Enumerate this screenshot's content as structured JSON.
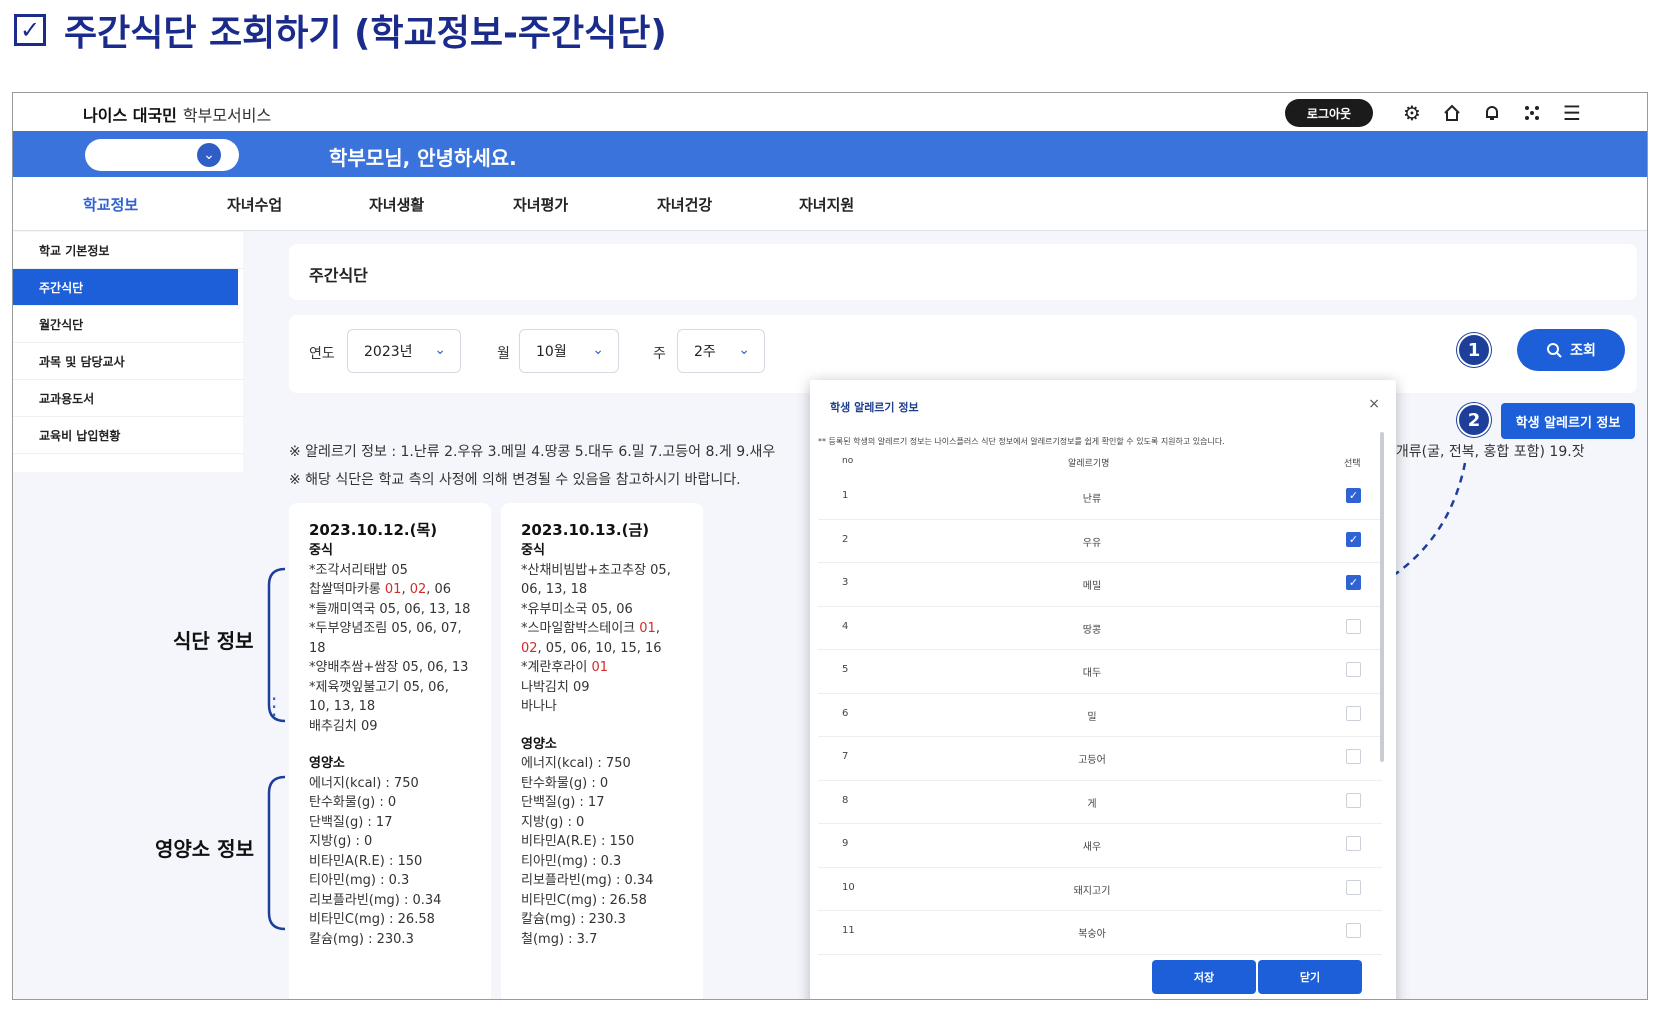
{
  "heading": {
    "checkbox": "☑",
    "title": "주간식단 조회하기 (학교정보-주간식단)"
  },
  "topbar": {
    "brand": "나이스 대국민",
    "brand_sub": "학부모서비스",
    "logout_label": "로그아웃",
    "icons": [
      "gear-icon",
      "home-icon",
      "bell-icon",
      "apps-icon",
      "menu-icon"
    ]
  },
  "hero": {
    "greeting": "학부모님, 안녕하세요."
  },
  "mainnav": {
    "tabs": [
      "학교정보",
      "자녀수업",
      "자녀생활",
      "자녀평가",
      "자녀건강",
      "자녀지원"
    ]
  },
  "sidebar": {
    "items": [
      "학교 기본정보",
      "주간식단",
      "월간식단",
      "과목 및 담당교사",
      "교과용도서",
      "교육비 납입현황"
    ]
  },
  "page_title": "주간식단",
  "filters": {
    "year_label": "연도",
    "year_value": "2023년",
    "month_label": "월",
    "month_value": "10월",
    "week_label": "주",
    "week_value": "2주",
    "search_label": "조회",
    "allergy_button": "학생 알레르기 정보"
  },
  "callouts": {
    "one": "1",
    "two": "2"
  },
  "notes": {
    "allergy": "※ 알레르기 정보 : 1.난류 2.우유 3.메밀 4.땅콩 5.대두 6.밀 7.고등어 8.게 9.새우",
    "allergy_tail": "조개류(굴, 전복, 홍합 포함) 19.잣",
    "change": "※ 해당 식단은 학교 측의 사정에 의해 변경될 수 있음을 참고하시기 바랍니다."
  },
  "labels": {
    "meal_info": "식단 정보",
    "nutrient_info": "영양소 정보"
  },
  "meals": [
    {
      "date": "2023.10.12.(목)",
      "type": "중식",
      "menu": [
        "*조각서리태밥 05",
        "찹쌀떡마카롱 ",
        "01",
        ", ",
        "02",
        ", 06",
        "*들깨미역국 05, 06, 13, 18",
        "*두부양념조림 05, 06, 07,",
        "18",
        "*양배추쌈+쌈장 05, 06, 13",
        "*제육깻잎불고기 05, 06,",
        "10, 13, 18",
        "배추김치 09"
      ],
      "nutrients_title": "영양소",
      "nutrients": [
        "에너지(kcal) : 750",
        "탄수화물(g) : 0",
        "단백질(g) : 17",
        "지방(g) : 0",
        "비타민A(R.E) : 150",
        "티아민(mg) : 0.3",
        "리보플라빈(mg) : 0.34",
        "비타민C(mg) : 26.58",
        "칼슘(mg) : 230.3"
      ]
    },
    {
      "date": "2023.10.13.(금)",
      "type": "중식",
      "menu": [
        "*산채비빔밥+초고추장 05,",
        "06, 13, 18",
        "*유부미소국 05, 06",
        "*스마일함박스테이크 ",
        "01",
        ",",
        "02",
        ", 05, 06, 10, 15, 16",
        "*계란후라이 ",
        "01",
        "나박김치 09",
        "바나나"
      ],
      "nutrients_title": "영양소",
      "nutrients": [
        "에너지(kcal) : 750",
        "탄수화물(g) : 0",
        "단백질(g) : 17",
        "지방(g) : 0",
        "비타민A(R.E) : 150",
        "티아민(mg) : 0.3",
        "리보플라빈(mg) : 0.34",
        "비타민C(mg) : 26.58",
        "칼슘(mg) : 230.3",
        "철(mg) : 3.7"
      ]
    }
  ],
  "modal": {
    "title": "학생 알레르기 정보",
    "close": "×",
    "note": "** 등록된 학생의 알레르기 정보는 나이스플러스 식단 정보에서 알레르기정보를 쉽게 확인할 수 있도록 지원하고 있습니다.",
    "col_no": "no",
    "col_name": "알레르기명",
    "col_select": "선택",
    "rows": [
      {
        "no": "1",
        "name": "난류",
        "checked": true
      },
      {
        "no": "2",
        "name": "우유",
        "checked": true
      },
      {
        "no": "3",
        "name": "메밀",
        "checked": true
      },
      {
        "no": "4",
        "name": "땅콩",
        "checked": false
      },
      {
        "no": "5",
        "name": "대두",
        "checked": false
      },
      {
        "no": "6",
        "name": "밀",
        "checked": false
      },
      {
        "no": "7",
        "name": "고등어",
        "checked": false
      },
      {
        "no": "8",
        "name": "게",
        "checked": false
      },
      {
        "no": "9",
        "name": "새우",
        "checked": false
      },
      {
        "no": "10",
        "name": "돼지고기",
        "checked": false
      },
      {
        "no": "11",
        "name": "복숭아",
        "checked": false
      }
    ],
    "save_label": "저장",
    "close_label": "닫기"
  },
  "colors": {
    "brand_blue": "#1c5fd8",
    "hero_blue": "#3a73db",
    "heading_navy": "#1a2b8c",
    "allergen_red": "#d42a2a",
    "callout_navy": "#1d3f9a"
  }
}
